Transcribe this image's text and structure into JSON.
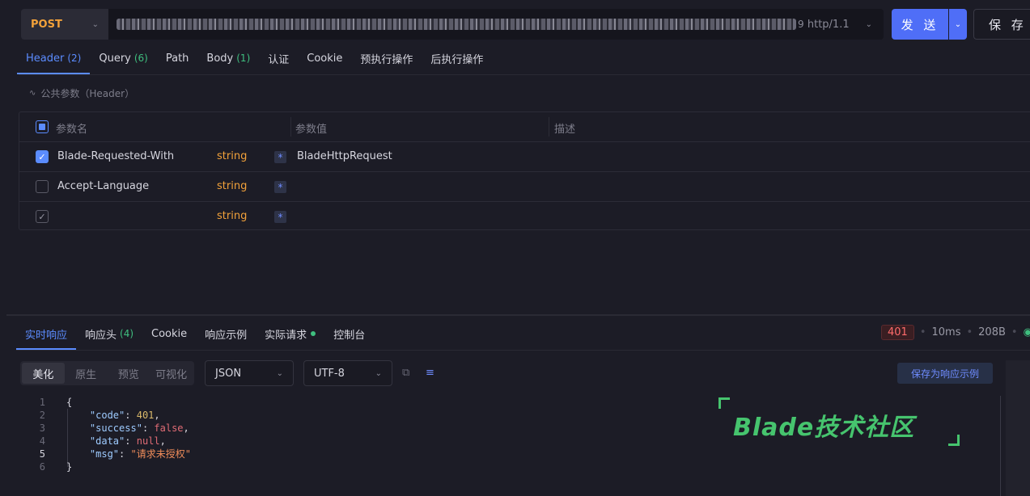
{
  "request": {
    "method": "POST",
    "url_suffix": "9",
    "protocol": "http/1.1",
    "send_label": "发 送",
    "save_label": "保 存"
  },
  "request_tabs": [
    {
      "label": "Header",
      "count": "(2)"
    },
    {
      "label": "Query",
      "count": "(6)"
    },
    {
      "label": "Path",
      "count": ""
    },
    {
      "label": "Body",
      "count": "(1)"
    },
    {
      "label": "认证",
      "count": ""
    },
    {
      "label": "Cookie",
      "count": ""
    },
    {
      "label": "预执行操作",
      "count": ""
    },
    {
      "label": "后执行操作",
      "count": ""
    }
  ],
  "public_params": "公共参数（Header）",
  "table": {
    "col_name": "参数名",
    "col_value": "参数值",
    "col_desc": "描述",
    "rows": [
      {
        "name": "Blade-Requested-With",
        "type": "string",
        "required": "*",
        "value": "BladeHttpRequest"
      },
      {
        "name": "Accept-Language",
        "type": "string",
        "required": "*",
        "value": ""
      },
      {
        "name": "",
        "type": "string",
        "required": "*",
        "value": ""
      }
    ]
  },
  "response_tabs": [
    {
      "label": "实时响应",
      "count": ""
    },
    {
      "label": "响应头",
      "count": "(4)"
    },
    {
      "label": "Cookie",
      "count": ""
    },
    {
      "label": "响应示例",
      "count": ""
    },
    {
      "label": "实际请求",
      "count": ""
    },
    {
      "label": "控制台",
      "count": ""
    }
  ],
  "status": {
    "code": "401",
    "time": "10ms",
    "size": "208B"
  },
  "view_modes": [
    "美化",
    "原生",
    "预览",
    "可视化"
  ],
  "format": "JSON",
  "encoding": "UTF-8",
  "save_example": "保存为响应示例",
  "code_lines": [
    "1",
    "2",
    "3",
    "4",
    "5",
    "6"
  ],
  "json_body": {
    "open": "{",
    "close": "}",
    "fields": [
      {
        "key": "\"code\"",
        "value": "401"
      },
      {
        "key": "\"success\"",
        "value": "false"
      },
      {
        "key": "\"data\"",
        "value": "null"
      },
      {
        "key": "\"msg\"",
        "value": "\"请求未授权\""
      }
    ]
  },
  "watermark": "Blade技术社区",
  "colors": {
    "accent": "#5b8cff",
    "method": "#f3a23a",
    "success": "#3fbf7f",
    "error": "#ff6b6b",
    "watermark": "#46c46e"
  }
}
